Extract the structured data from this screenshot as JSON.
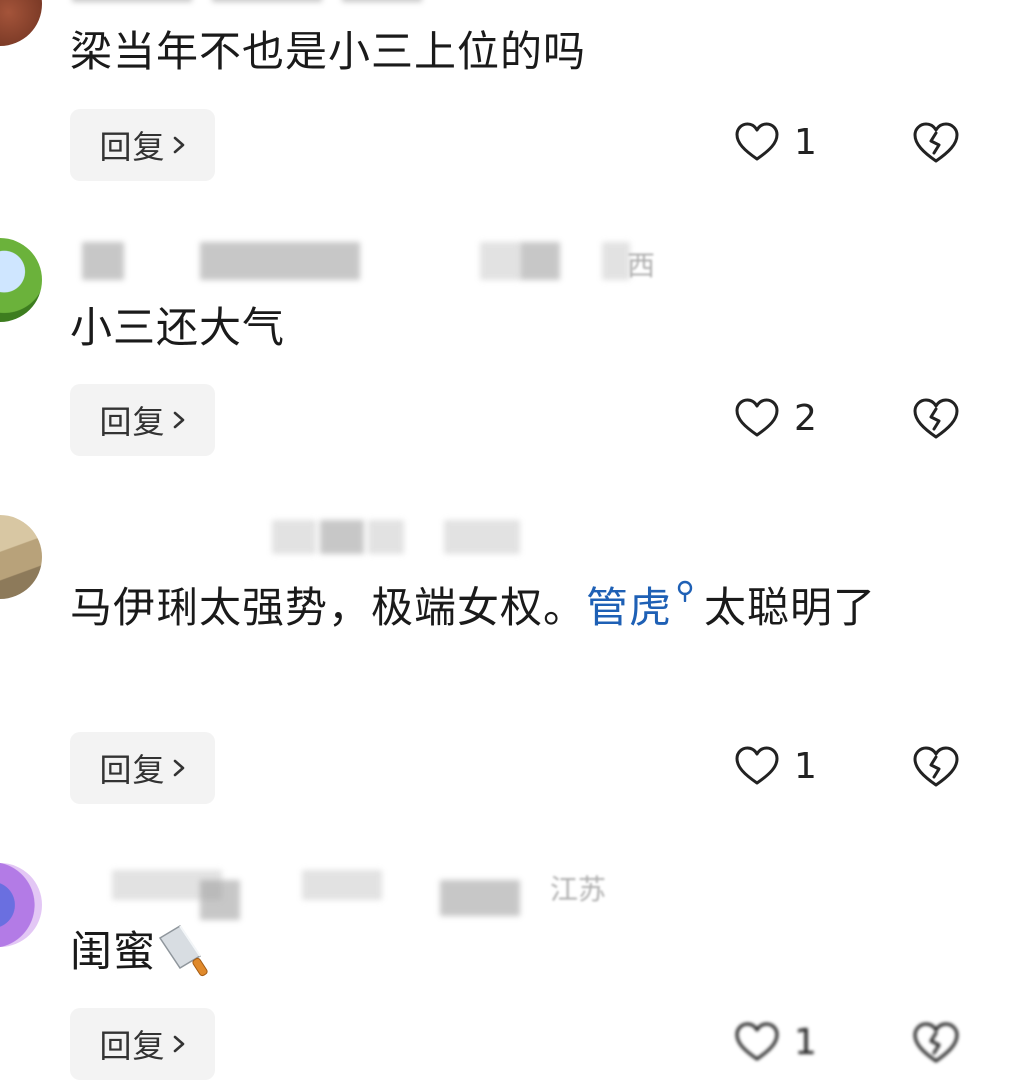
{
  "comments": [
    {
      "text": "梁当年不也是小三上位的吗",
      "likes": "1",
      "reply_label": "回复"
    },
    {
      "meta_location": "西",
      "text": "小三还大气",
      "likes": "2",
      "reply_label": "回复"
    },
    {
      "text_before_link": "马伊琍太强势，极端女权。",
      "link_text": "管虎",
      "text_after_link": "太聪明了",
      "likes": "1",
      "reply_label": "回复"
    },
    {
      "meta_location": "江苏",
      "text": "闺蜜",
      "likes": "1",
      "reply_label": "回复"
    }
  ],
  "icons": {
    "like": "heart-outline-icon",
    "dislike": "broken-heart-icon",
    "reply_arrow": "chevron-right-icon",
    "search": "search-icon",
    "emoji": "cleaver-emoji"
  },
  "colors": {
    "link": "#1e60b5",
    "reply_bg": "#f3f3f3",
    "text": "#1a1a1a"
  }
}
